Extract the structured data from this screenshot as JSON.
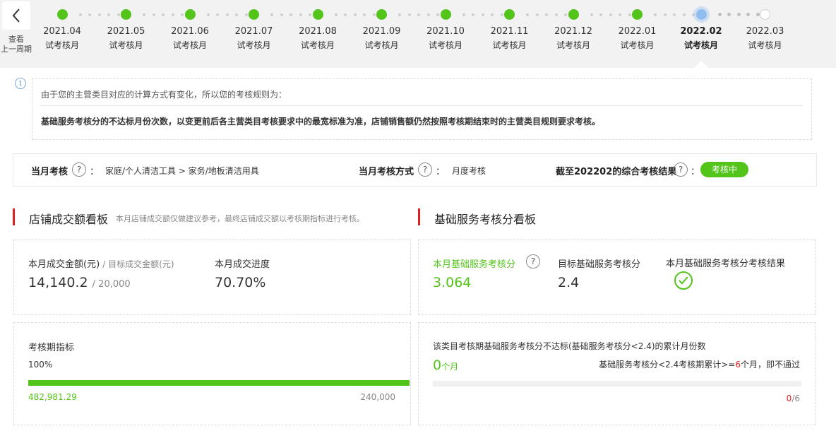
{
  "nav": {
    "back_label_line1": "查看",
    "back_label_line2": "上一周期"
  },
  "timeline": [
    {
      "date": "2021.04",
      "status": "试考核月",
      "state": "done"
    },
    {
      "date": "2021.05",
      "status": "试考核月",
      "state": "done"
    },
    {
      "date": "2021.06",
      "status": "试考核月",
      "state": "done"
    },
    {
      "date": "2021.07",
      "status": "试考核月",
      "state": "done"
    },
    {
      "date": "2021.08",
      "status": "试考核月",
      "state": "done"
    },
    {
      "date": "2021.09",
      "status": "试考核月",
      "state": "done"
    },
    {
      "date": "2021.10",
      "status": "试考核月",
      "state": "done"
    },
    {
      "date": "2021.11",
      "status": "试考核月",
      "state": "done"
    },
    {
      "date": "2021.12",
      "status": "试考核月",
      "state": "done"
    },
    {
      "date": "2022.01",
      "status": "试考核月",
      "state": "done"
    },
    {
      "date": "2022.02",
      "status": "试考核月",
      "state": "current"
    },
    {
      "date": "2022.03",
      "status": "试考核月",
      "state": "future"
    }
  ],
  "notice": {
    "line1": "由于您的主营类目对应的计算方式有变化，所以您的考核规则为：",
    "line2": "基础服务考核分的不达标月份次数，以变更前后各主营类目考核要求中的最宽标准为准，店铺销售额仍然按照考核期结束时的主营类目规则要求考核。"
  },
  "summary": {
    "month_label": "当月考核",
    "month_value": "家庭/个人清洁工具 > 家务/地板清洁用具",
    "method_label": "当月考核方式",
    "method_value": "月度考核",
    "result_label": "截至202202的综合考核结果",
    "result_badge": "考核中",
    "colon": "："
  },
  "sales": {
    "title": "店铺成交额看板",
    "subtitle": "本月店铺成交额仅做建议参考，最终店铺成交额以考核期指标进行考核。",
    "amount_label": "本月成交金额(元)",
    "target_label": "/ 目标成交金额(元)",
    "amount_value": "14,140.2",
    "target_value": "/ 20,000",
    "progress_label": "本月成交进度",
    "progress_value": "70.70%",
    "period_label": "考核期指标",
    "period_percent": "100%",
    "period_progress": 1.0,
    "period_actual": "482,981.29",
    "period_target": "240,000"
  },
  "service": {
    "title": "基础服务考核分看板",
    "score_label": "本月基础服务考核分",
    "score_value": "3.064",
    "target_label": "目标基础服务考核分",
    "target_value": "2.4",
    "result_label": "本月基础服务考核分考核结果",
    "fail_title": "该类目考核期基础服务考核分不达标(基础服务考核分<2.4)的累计月份数",
    "fail_count": "0",
    "fail_unit": "个月",
    "rule_prefix": "基础服务考核分<2.4考核期累计>=",
    "rule_num": "6",
    "rule_suffix": "个月，即不通过",
    "ratio_num": "0",
    "ratio_den": "/6"
  },
  "colors": {
    "green": "#52c41a",
    "red": "#e02020",
    "current_dot": "#8fbdf0"
  }
}
